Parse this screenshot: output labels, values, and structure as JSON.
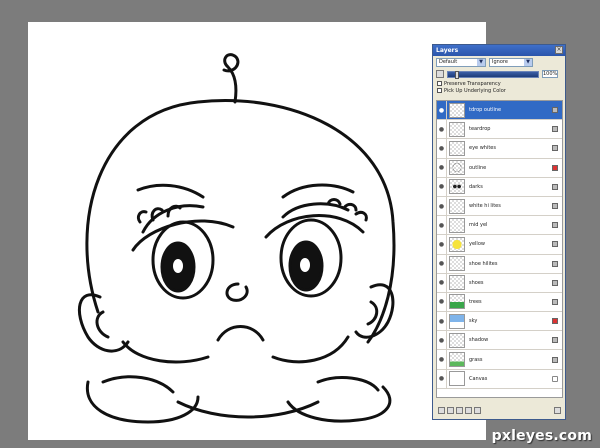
{
  "panel": {
    "title": "Layers",
    "close_glyph": "×",
    "blend_mode": "Default",
    "ignore_mode": "Ignore",
    "opacity_value": "100%",
    "opacity_fraction": 0.08,
    "preserve_transparency_label": "Preserve Transparency",
    "pick_up_color_label": "Pick Up Underlying Color"
  },
  "layers": [
    {
      "name": "tdrop outline",
      "selected": true,
      "thumb": "blank",
      "icon": "gray"
    },
    {
      "name": "teardrop",
      "selected": false,
      "thumb": "blank",
      "icon": "gray"
    },
    {
      "name": "eye whites",
      "selected": false,
      "thumb": "blank",
      "icon": "gray"
    },
    {
      "name": "outline",
      "selected": false,
      "thumb": "outline",
      "icon": "red"
    },
    {
      "name": "darks",
      "selected": false,
      "thumb": "darks",
      "icon": "gray"
    },
    {
      "name": "white hi lites",
      "selected": false,
      "thumb": "blank",
      "icon": "gray"
    },
    {
      "name": "mid yel",
      "selected": false,
      "thumb": "blank",
      "icon": "gray"
    },
    {
      "name": "yellow",
      "selected": false,
      "thumb": "yellow",
      "icon": "gray"
    },
    {
      "name": "shoe hilites",
      "selected": false,
      "thumb": "blank",
      "icon": "gray"
    },
    {
      "name": "shoes",
      "selected": false,
      "thumb": "blank",
      "icon": "gray"
    },
    {
      "name": "trees",
      "selected": false,
      "thumb": "trees",
      "icon": "gray"
    },
    {
      "name": "sky",
      "selected": false,
      "thumb": "sky",
      "icon": "red"
    },
    {
      "name": "shadow",
      "selected": false,
      "thumb": "blank",
      "icon": "gray"
    },
    {
      "name": "grass",
      "selected": false,
      "thumb": "grass",
      "icon": "gray"
    },
    {
      "name": "Canvas",
      "selected": false,
      "thumb": "white",
      "icon": "lock"
    }
  ],
  "watermark": "pxleyes.com",
  "colors": {
    "workspace": "#7c7c7c",
    "selection": "#316ac5",
    "titlebar": "#2a55ab"
  }
}
